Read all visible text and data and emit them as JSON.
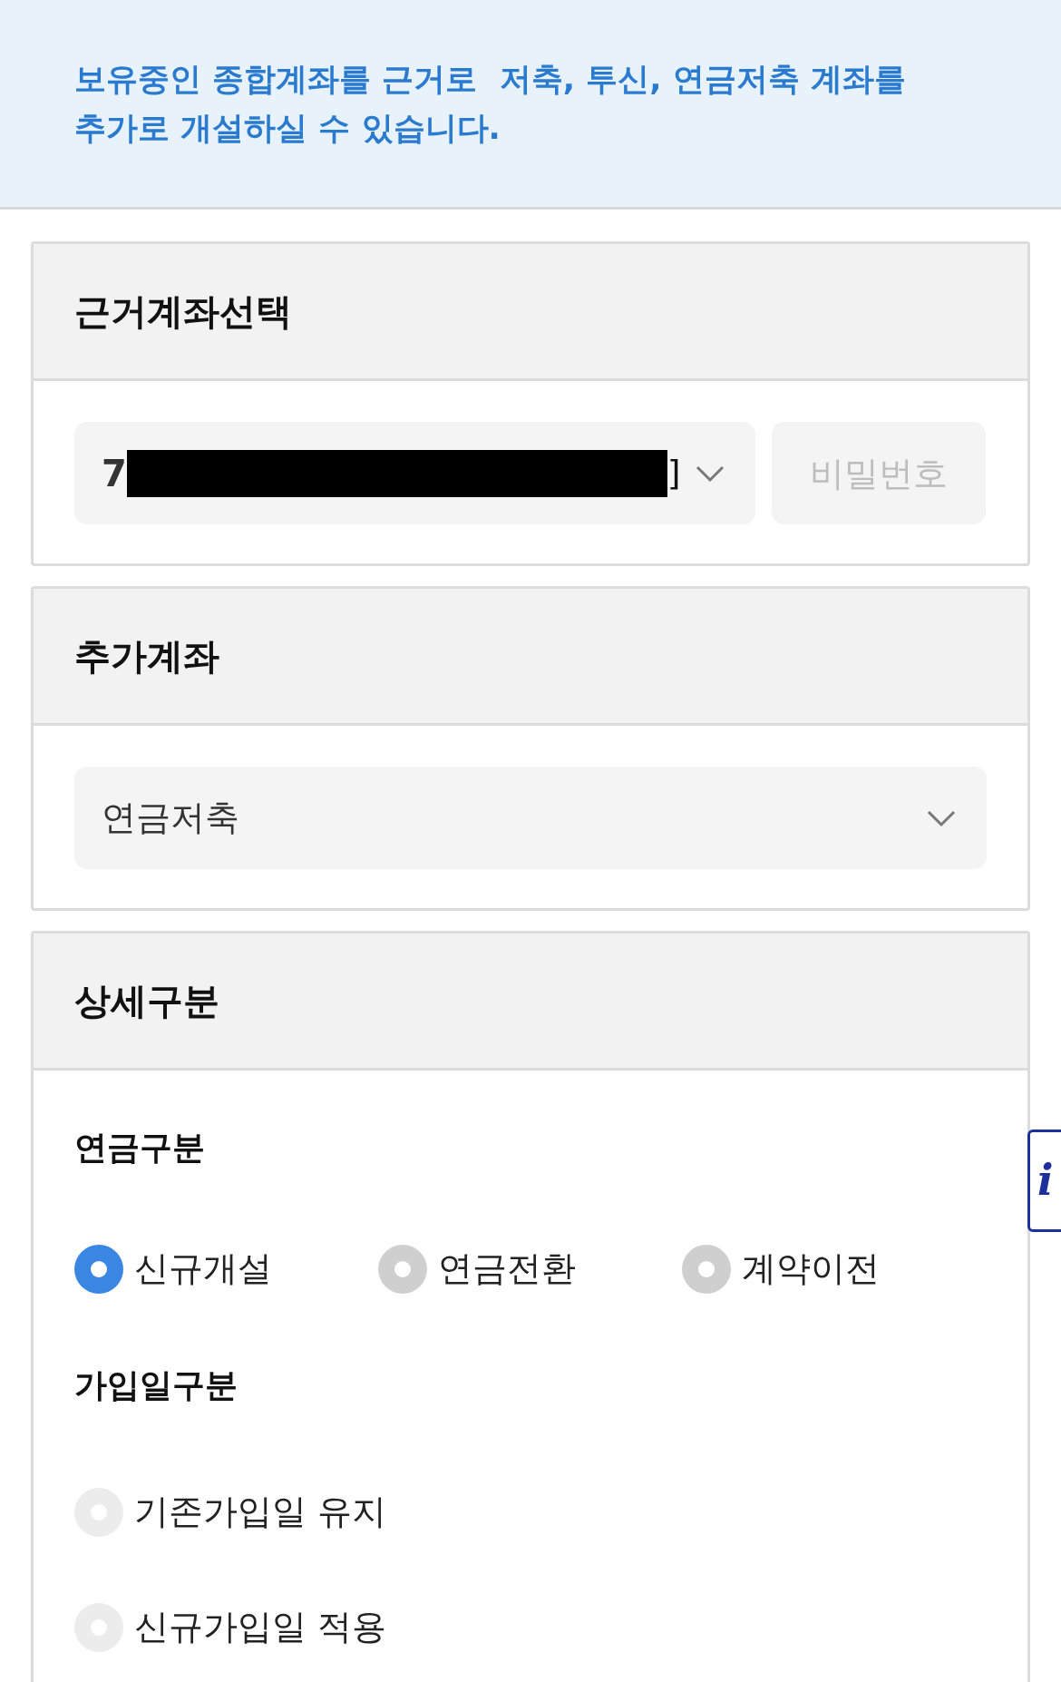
{
  "notice": {
    "lines": [
      "보유중인 종합계좌를 근거로  저축, 투신, 연금저축 계좌를",
      "추가로 개설하실 수 있습니다."
    ]
  },
  "base_account": {
    "title": "근거계좌선택",
    "account_prefix": "7",
    "account_suffix": "]",
    "password_placeholder": "비밀번호"
  },
  "add_account": {
    "title": "추가계좌",
    "value": "연금저축"
  },
  "detail": {
    "title": "상세구분",
    "groups": [
      {
        "label": "연금구분",
        "kind": "inline",
        "options": [
          {
            "label": "신규개설",
            "selected": true,
            "disabled": false
          },
          {
            "label": "연금전환",
            "selected": false,
            "disabled": false
          },
          {
            "label": "계약이전",
            "selected": false,
            "disabled": false
          }
        ]
      },
      {
        "label": "가입일구분",
        "kind": "stacked",
        "options": [
          {
            "label": "기존가입일 유지",
            "selected": false,
            "disabled": true
          },
          {
            "label": "신규가입일 적용",
            "selected": false,
            "disabled": true
          }
        ]
      }
    ]
  },
  "info_button": {
    "label": "i"
  }
}
